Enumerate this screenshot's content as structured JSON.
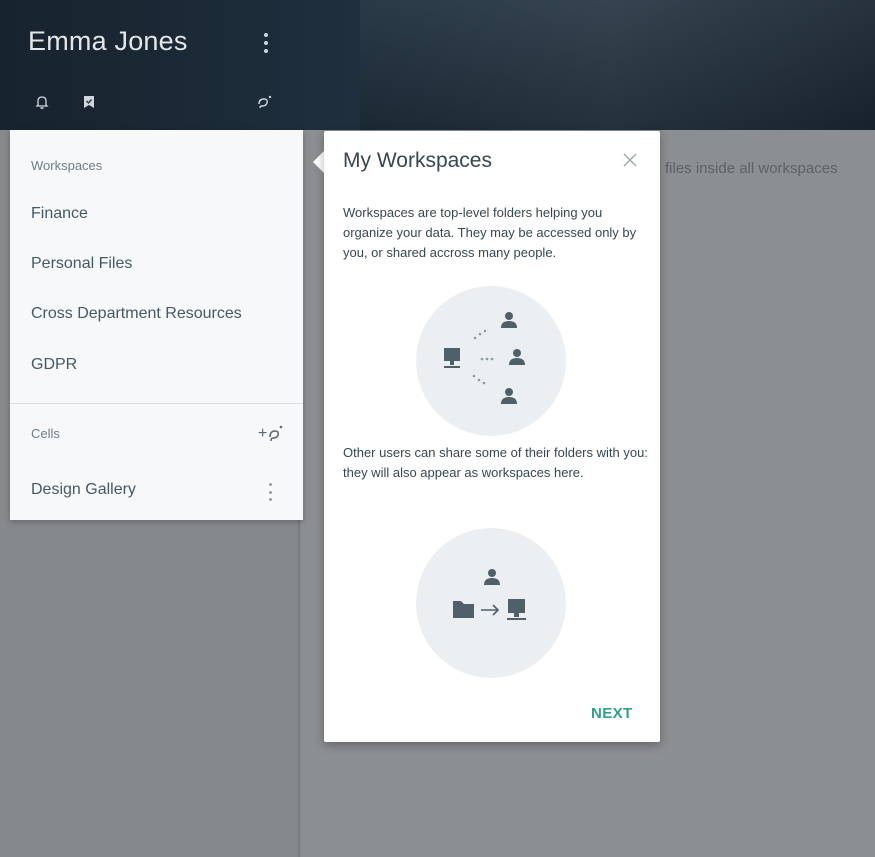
{
  "header": {
    "user_name": "Emma Jones"
  },
  "background": {
    "search_hint": "files inside all workspaces"
  },
  "drawer": {
    "workspaces_title": "Workspaces",
    "workspaces": [
      {
        "label": "Finance"
      },
      {
        "label": "Personal Files"
      },
      {
        "label": "Cross Department Resources"
      },
      {
        "label": "GDPR"
      }
    ],
    "cells_title": "Cells",
    "cells": [
      {
        "label": "Design Gallery"
      }
    ]
  },
  "popover": {
    "title": "My Workspaces",
    "paragraph_1": "Workspaces are top-level folders helping you organize your data. They may be accessed only by you, or shared accross many people.",
    "paragraph_2": "Other users can share some of their folders with you: they will also appear as workspaces here.",
    "next_label": "NEXT"
  },
  "icons": {
    "notifications": "bell-icon",
    "bookmarks": "bookmark-check-icon",
    "cells": "cells-logo-icon",
    "add_cell": "add-cell-icon",
    "close": "close-icon"
  },
  "colors": {
    "accent": "#2f9e8f",
    "text": "#37474f",
    "header_bg": "#1f2f3d",
    "illustration_bg": "#eceff1"
  }
}
